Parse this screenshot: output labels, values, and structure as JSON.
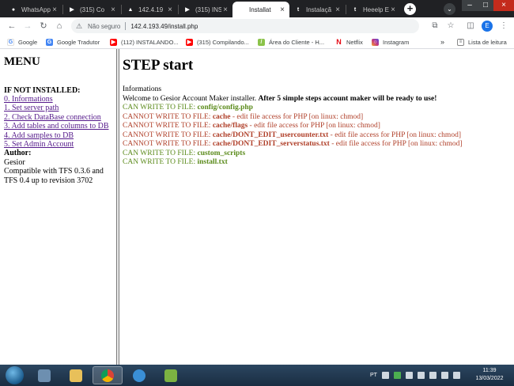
{
  "tabs": [
    {
      "label": "WhatsApp",
      "icon": "whatsapp-icon",
      "color": "#25d366",
      "active": false
    },
    {
      "label": "(315) Co",
      "icon": "youtube-icon",
      "color": "#ff0000",
      "active": false
    },
    {
      "label": "142.4.19",
      "icon": "otland-icon",
      "color": "#c9a227",
      "active": false
    },
    {
      "label": "(315) INS",
      "icon": "youtube-icon",
      "color": "#ff0000",
      "active": false
    },
    {
      "label": "Installat",
      "icon": "globe-icon",
      "color": "#5f6368",
      "active": true
    },
    {
      "label": "Instalaçã",
      "icon": "tibia-icon",
      "color": "#e3b51d",
      "active": false
    },
    {
      "label": "Heeelp E",
      "icon": "tibia-icon",
      "color": "#e3b51d",
      "active": false
    }
  ],
  "toolbar": {
    "security_label": "Não seguro",
    "url": "142.4.193.49/install.php",
    "profile_initial": "E"
  },
  "bookmarks": [
    {
      "label": "Google",
      "icon": "google-icon",
      "color": "#4285f4"
    },
    {
      "label": "Google Tradutor",
      "icon": "translate-icon",
      "color": "#4285f4"
    },
    {
      "label": "(112) INSTALANDO...",
      "icon": "youtube-icon",
      "color": "#ff0000"
    },
    {
      "label": "(315) Compilando...",
      "icon": "youtube-icon",
      "color": "#ff0000"
    },
    {
      "label": "Área do Cliente - H...",
      "icon": "client-area-icon",
      "color": "#8bc34a"
    },
    {
      "label": "Netflix",
      "icon": "netflix-icon",
      "color": "#e50914"
    },
    {
      "label": "Instagram",
      "icon": "instagram-icon",
      "color": "#c13584"
    }
  ],
  "bookmarks_more": "»",
  "reading_list": "Lista de leitura",
  "menu": {
    "title": "MENU",
    "subtitle": "IF NOT INSTALLED:",
    "links": [
      "0. Informations",
      "1. Set server path",
      "2. Check DataBase connection",
      "3. Add tables and columns to DB",
      "4. Add samples to DB",
      "5. Set Admin Account"
    ],
    "author_label": "Author:",
    "author_name": "Gesior",
    "compat_line1": "Compatible with TFS 0.3.6 and",
    "compat_line2": "TFS 0.4 up to revision 3702"
  },
  "main": {
    "title": "STEP start",
    "info_label": "Informations",
    "welcome_text": "Welcome to Gesior Account Maker installer. ",
    "welcome_bold": "After 5 simple steps account maker will be ready to use!",
    "lines": [
      {
        "status": "ok",
        "prefix": "CAN WRITE TO FILE: ",
        "file": "config/config.php",
        "suffix": ""
      },
      {
        "status": "bad",
        "prefix": "CANNOT WRITE TO FILE: ",
        "file": "cache",
        "suffix": " - edit file access for PHP [on linux: chmod]"
      },
      {
        "status": "bad",
        "prefix": "CANNOT WRITE TO FILE: ",
        "file": "cache/flags",
        "suffix": " - edit file access for PHP [on linux: chmod]"
      },
      {
        "status": "bad",
        "prefix": "CANNOT WRITE TO FILE: ",
        "file": "cache/DONT_EDIT_usercounter.txt",
        "suffix": " - edit file access for PHP [on linux: chmod]"
      },
      {
        "status": "bad",
        "prefix": "CANNOT WRITE TO FILE: ",
        "file": "cache/DONT_EDIT_serverstatus.txt",
        "suffix": " - edit file access for PHP [on linux: chmod]"
      },
      {
        "status": "ok",
        "prefix": "CAN WRITE TO FILE: ",
        "file": "custom_scripts",
        "suffix": ""
      },
      {
        "status": "ok",
        "prefix": "CAN WRITE TO FILE: ",
        "file": "install.txt",
        "suffix": ""
      }
    ]
  },
  "taskbar": {
    "language": "PT",
    "time": "11:39",
    "date": "13/03/2022",
    "apps": [
      {
        "icon": "windows-explorer-icon",
        "color": "#6d8fb0",
        "active": false
      },
      {
        "icon": "folder-icon",
        "color": "#e8c05a",
        "active": false
      },
      {
        "icon": "chrome-icon",
        "color": "#db4437",
        "active": true
      },
      {
        "icon": "cloud-app-icon",
        "color": "#3a8fd6",
        "active": false
      },
      {
        "icon": "notepad-plus-icon",
        "color": "#7cb342",
        "active": false
      }
    ]
  }
}
